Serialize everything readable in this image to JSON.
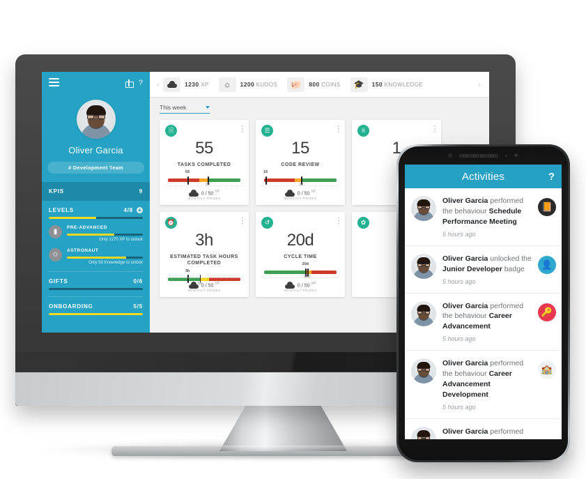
{
  "desktop": {
    "sidebar": {
      "menu_icon": "hamburger-icon",
      "gift_icon": "gift-icon",
      "help_icon": "?",
      "user_name": "Oliver Garcia",
      "team_label": "# Development Team",
      "kpis": {
        "label": "KPIS",
        "value": "9"
      },
      "levels": {
        "label": "LEVELS",
        "value": "4/8",
        "progress_pct": 50,
        "badges": [
          {
            "icon": "cube-icon",
            "title": "PRE-ADVANCED",
            "progress_pct": 62,
            "note": "Only 1270 XP to unlock"
          },
          {
            "icon": "rocket-icon",
            "title": "ASTRONAUT",
            "progress_pct": 78,
            "note": "Only 50 Knowledge to unlock"
          }
        ]
      },
      "gifts": {
        "label": "GIFTS",
        "value": "0/6",
        "progress_pct": 0
      },
      "onboarding": {
        "label": "ONBOARDING",
        "value": "5/5",
        "progress_pct": 100
      }
    },
    "topbar": {
      "prev_arrow": "‹",
      "next_arrow": "›",
      "stats": [
        {
          "icon": "cloud-icon",
          "amount": "1230",
          "unit": "XP"
        },
        {
          "icon": "sun-icon",
          "amount": "1200",
          "unit": "KUDOS"
        },
        {
          "icon": "piggy-bank-icon",
          "amount": "800",
          "unit": "COINS"
        },
        {
          "icon": "graduation-cap-icon",
          "amount": "150",
          "unit": "KNOWLEDGE"
        }
      ]
    },
    "filter": {
      "label": "This week",
      "caret": "chevron-down-icon"
    },
    "cards": [
      {
        "icon": "document-check-icon",
        "icon_color": "#22b191",
        "value": "55",
        "label": "TASKS COMPLETED",
        "gauge": {
          "segments": [
            {
              "color": "#cf3a2b",
              "pct": 43
            },
            {
              "color": "#f5a623",
              "pct": 12
            },
            {
              "color": "#3f9e53",
              "pct": 45
            }
          ],
          "markers": [
            {
              "pct": 27
            },
            {
              "pct": 55
            }
          ],
          "top_label": {
            "text": "55",
            "pct": 27
          },
          "bottom_label": {
            "text": "80",
            "pct": 55
          }
        },
        "prize": "0 / 50",
        "prize_unit": "XP",
        "prize_sub": "MONTHLY PRIZES"
      },
      {
        "icon": "code-review-icon",
        "icon_color": "#22b191",
        "value": "15",
        "label": "CODE REVIEW",
        "gauge": {
          "segments": [
            {
              "color": "#cf3a2b",
              "pct": 42
            },
            {
              "color": "#f5a623",
              "pct": 9
            },
            {
              "color": "#3f9e53",
              "pct": 49
            }
          ],
          "markers": [
            {
              "pct": 2
            },
            {
              "pct": 51
            }
          ],
          "top_label": {
            "text": "15",
            "pct": 2
          },
          "bottom_label": {
            "text": "30",
            "pct": 51
          }
        },
        "prize": "0 / 50",
        "prize_unit": "XP",
        "prize_sub": "MONTHLY PRIZES"
      },
      {
        "icon": "person-trophy-icon",
        "icon_color": "#22b191",
        "value": "1",
        "label": "",
        "gauge": null,
        "prize": "",
        "prize_unit": "",
        "prize_sub": ""
      },
      {
        "icon": "clock-hours-icon",
        "icon_color": "#22b191",
        "value": "3h",
        "label": "ESTIMATED TASK HOURS COMPLETED",
        "gauge": {
          "segments": [
            {
              "color": "#3f9e53",
              "pct": 45
            },
            {
              "color": "#f5d820",
              "pct": 12
            },
            {
              "color": "#cf3a2b",
              "pct": 43
            }
          ],
          "markers": [
            {
              "pct": 27
            },
            {
              "pct": 44
            }
          ],
          "top_label": {
            "text": "3h",
            "pct": 27
          },
          "bottom_label": {
            "text": "5h",
            "pct": 44
          }
        },
        "prize": "0 / 50",
        "prize_unit": "XP",
        "prize_sub": "MONTHLY PRIZES"
      },
      {
        "icon": "cycle-time-icon",
        "icon_color": "#22b191",
        "value": "20d",
        "label": "CYCLE TIME",
        "gauge": {
          "segments": [
            {
              "color": "#3f9e53",
              "pct": 58
            },
            {
              "color": "#f5a623",
              "pct": 7
            },
            {
              "color": "#cf3a2b",
              "pct": 35
            }
          ],
          "markers": [
            {
              "pct": 57
            },
            {
              "pct": 60
            }
          ],
          "top_label": {
            "text": "20d",
            "pct": 57
          },
          "bottom_label": {
            "text": "21d",
            "pct": 59
          }
        },
        "prize": "0 / 50",
        "prize_unit": "XP",
        "prize_sub": "MONTHLY PRIZES"
      },
      {
        "icon": "leaf-icon",
        "icon_color": "#22b191",
        "value": "",
        "label": "",
        "gauge": null,
        "prize": "",
        "prize_unit": "",
        "prize_sub": ""
      }
    ]
  },
  "phone": {
    "header": {
      "title": "Activities",
      "help_icon": "?"
    },
    "activities": [
      {
        "avatar": "user-avatar",
        "prefix": "Oliver Garcia",
        "middle": " performed the behaviour ",
        "highlight": "Schedule Performance Meeting",
        "suffix": "",
        "time": "5 hours ago",
        "badge_glyph": "📙",
        "badge_color": "#2b2b2b"
      },
      {
        "avatar": "user-avatar",
        "prefix": "Oliver Garcia",
        "middle": " unlocked the ",
        "highlight": "Junior Developer",
        "suffix": " badge",
        "time": "5 hours ago",
        "badge_glyph": "👤",
        "badge_color": "#2fa8cf"
      },
      {
        "avatar": "user-avatar",
        "prefix": "Oliver Garcia",
        "middle": " performed the behaviour ",
        "highlight": "Career Advancement",
        "suffix": "",
        "time": "5 hours ago",
        "badge_glyph": "🔑",
        "badge_color": "#e8384f"
      },
      {
        "avatar": "user-avatar",
        "prefix": "Oliver Garcia",
        "middle": " performed the behaviour ",
        "highlight": "Career Advancement Development",
        "suffix": "",
        "time": "5 hours ago",
        "badge_glyph": "🏫",
        "badge_color": "#f0f2f4"
      },
      {
        "avatar": "user-avatar",
        "prefix": "Oliver Garcia",
        "middle": " performed",
        "highlight": "",
        "suffix": "",
        "time": "",
        "badge_glyph": "",
        "badge_color": "#ffffff"
      }
    ]
  }
}
